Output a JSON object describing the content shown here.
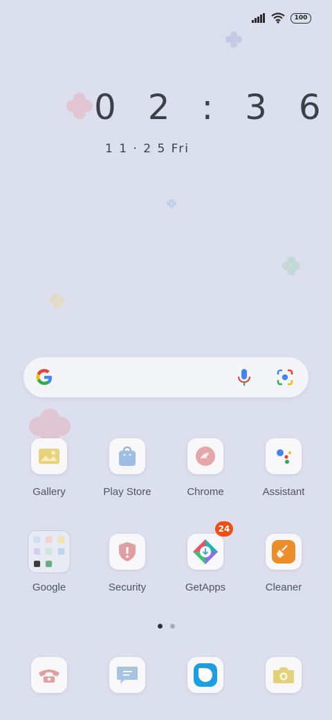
{
  "status": {
    "battery": "100"
  },
  "lockclock": {
    "time": "0 2 : 3 6",
    "date": "1 1 · 2 5  Fri"
  },
  "apps_row1": [
    {
      "label": "Gallery"
    },
    {
      "label": "Play Store"
    },
    {
      "label": "Chrome"
    },
    {
      "label": "Assistant"
    }
  ],
  "apps_row2": [
    {
      "label": "Google"
    },
    {
      "label": "Security"
    },
    {
      "label": "GetApps",
      "badge": "24"
    },
    {
      "label": "Cleaner"
    }
  ],
  "dock": [
    {
      "name": "Phone"
    },
    {
      "name": "Messages"
    },
    {
      "name": "Browser"
    },
    {
      "name": "Camera"
    }
  ],
  "colors": {
    "background": "#dcdfee",
    "badge": "#ef4f15",
    "active_dot": "#2f3340",
    "inactive_dot": "#a8acb8"
  }
}
